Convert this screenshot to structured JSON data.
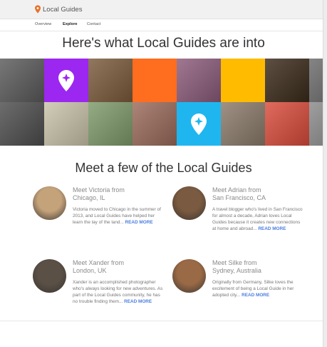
{
  "brand": {
    "name": "Local Guides",
    "pin_color": "#e8712a"
  },
  "nav": {
    "items": [
      {
        "label": "Overview",
        "active": false
      },
      {
        "label": "Explore",
        "active": true
      },
      {
        "label": "Contact",
        "active": false
      }
    ]
  },
  "interests": {
    "title": "Here's what Local Guides are into",
    "tiles": [
      {
        "icon": "coffee-machine-photo",
        "color": "#5a5a5a"
      },
      {
        "icon": "local-guides-pin-icon",
        "color": "#9c27f0"
      },
      {
        "icon": "friends-selfie-photo",
        "color": "#7a5a3a"
      },
      {
        "icon": "orange-tile",
        "color": "#ff6d1f"
      },
      {
        "icon": "table-graffiti-photo",
        "color": "#8b5a7a"
      },
      {
        "icon": "yellow-tile",
        "color": "#ffbb00"
      },
      {
        "icon": "person-lights-photo",
        "color": "#3a2a1a"
      },
      {
        "icon": "partial-photo",
        "color": "#6a6a6a"
      },
      {
        "icon": "woman-cafe-photo",
        "color": "#4d4d4d"
      },
      {
        "icon": "food-plate-photo",
        "color": "#c9c3a9"
      },
      {
        "icon": "river-trees-photo",
        "color": "#7d9a6a"
      },
      {
        "icon": "coffee-cup-photo",
        "color": "#9a6a5a"
      },
      {
        "icon": "local-guides-pin-icon",
        "color": "#1fb6f0"
      },
      {
        "icon": "street-crowd-photo",
        "color": "#8a7a6a"
      },
      {
        "icon": "tickets-photo",
        "color": "#d94b3a"
      },
      {
        "icon": "partial-photo",
        "color": "#8a8a8a"
      }
    ]
  },
  "guides": {
    "title": "Meet a few of the Local Guides",
    "items": [
      {
        "name_line1": "Meet Victoria from",
        "name_line2": "Chicago, IL",
        "bio": "Victoria moved to Chicago in the summer of 2013, and Local Guides have helped her learn the lay of the land...",
        "read_more": "READ MORE",
        "avatar_color": "#c4a27a"
      },
      {
        "name_line1": "Meet Adrian from",
        "name_line2": "San Francisco, CA",
        "bio": "A travel blogger who's lived in San Francisco for almost a decade, Adrian loves Local Guides because it creates new connections at home and abroad...",
        "read_more": "READ MORE",
        "avatar_color": "#7a5a40"
      },
      {
        "name_line1": "Meet Xander from",
        "name_line2": "London, UK",
        "bio": "Xander is an accomplished photographer who's always looking for new adventures. As part of the Local Guides community, he has no trouble finding them...",
        "read_more": "READ MORE",
        "avatar_color": "#5a5046"
      },
      {
        "name_line1": "Meet Silke from",
        "name_line2": "Sydney, Australia",
        "bio": "Originally from Germany, Silke loves the excitement of being a Local Guide in her adopted city...",
        "read_more": "READ MORE",
        "avatar_color": "#9a6a46"
      }
    ]
  }
}
